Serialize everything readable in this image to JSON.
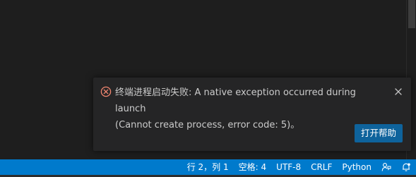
{
  "notification": {
    "message_line1": "终端进程启动失败: A native exception occurred during launch",
    "message_line2": "(Cannot create process, error code: 5)。",
    "icon": "error-circle-icon",
    "close_icon": "close-icon",
    "action_button": "打开帮助"
  },
  "status_bar": {
    "cursor_position": "行 2，列 1",
    "indentation": "空格: 4",
    "encoding": "UTF-8",
    "line_endings": "CRLF",
    "language": "Python",
    "feedback_icon": "feedback-person-icon",
    "notifications_icon": "bell-icon"
  },
  "colors": {
    "status_bar": "#007acc",
    "error": "#f48771",
    "button": "#0e639c",
    "background": "#1e1e1e",
    "toast": "#252526"
  }
}
